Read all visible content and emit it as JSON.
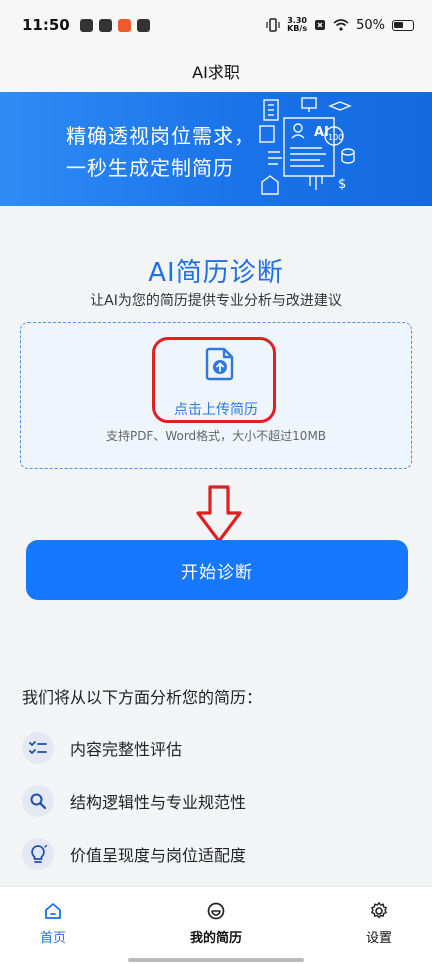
{
  "status_bar": {
    "time": "11:50",
    "net_speed_value": "3.30",
    "net_speed_unit": "KB/s",
    "battery": "50%"
  },
  "header": {
    "title": "AI求职"
  },
  "banner": {
    "line1": "精确透视岗位需求，",
    "line2": "一秒生成定制简历",
    "badge_ai": "AI",
    "badge_score": "100"
  },
  "diagnosis": {
    "title": "AI简历诊断",
    "subtitle": "让AI为您的简历提供专业分析与改进建议",
    "upload_label": "点击上传简历",
    "upload_hint": "支持PDF、Word格式，大小不超过10MB",
    "start_button": "开始诊断"
  },
  "aspects": {
    "title": "我们将从以下方面分析您的简历：",
    "items": [
      {
        "label": "内容完整性评估",
        "icon": "checklist-icon"
      },
      {
        "label": "结构逻辑性与专业规范性",
        "icon": "search-icon"
      },
      {
        "label": "价值呈现度与岗位适配度",
        "icon": "lightbulb-icon"
      }
    ]
  },
  "nav": {
    "items": [
      {
        "label": "首页",
        "icon": "home-icon",
        "active": true
      },
      {
        "label": "我的简历",
        "icon": "resume-icon",
        "active": false
      },
      {
        "label": "设置",
        "icon": "gear-icon",
        "active": false
      }
    ]
  },
  "colors": {
    "accent": "#1677ff",
    "title_blue": "#1f6fe8",
    "highlight_red": "#e02020"
  }
}
